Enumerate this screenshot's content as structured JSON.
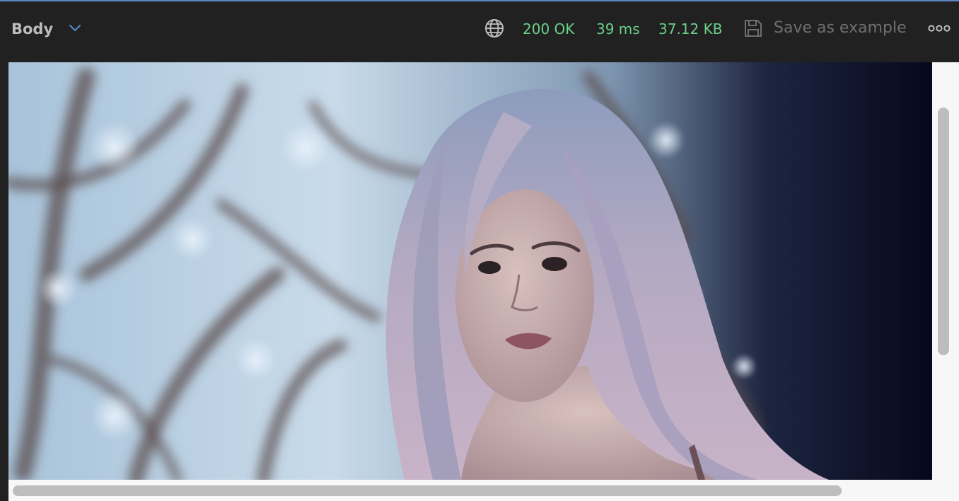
{
  "toolbar": {
    "body_dropdown_label": "Body",
    "status_code": "200 OK",
    "response_time": "39 ms",
    "response_size": "37.12 KB",
    "save_label": "Save as example",
    "icons": {
      "dropdown": "chevron-down-icon",
      "network": "globe-icon",
      "save": "save-icon",
      "more": "more-options-icon"
    }
  },
  "colors": {
    "accent": "#5b86c9",
    "status": "#6bd089",
    "toolbar_bg": "#212121",
    "muted_text": "#6f6f6f"
  },
  "viewer": {
    "content": "image-response-preview"
  }
}
